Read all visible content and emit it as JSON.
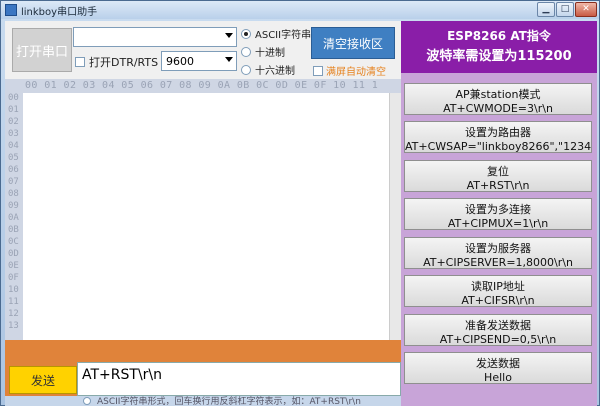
{
  "window": {
    "title": "linkboy串口助手"
  },
  "controls": {
    "open_port_label": "打开串口",
    "port_value": "",
    "dtr_label": "打开DTR/RTS",
    "baud_value": "9600",
    "radios": [
      {
        "label": "ASCII字符串",
        "selected": true
      },
      {
        "label": "十进制",
        "selected": false
      },
      {
        "label": "十六进制",
        "selected": false
      }
    ],
    "clear_rx_label": "清空接收区",
    "auto_clear_label": "满屏自动清空"
  },
  "hex_view": {
    "header": "00 01 02 03 04 05 06 07 08 09 0A 0B 0C 0D 0E 0F 10 11 1",
    "rows": [
      "00",
      "01",
      "02",
      "03",
      "04",
      "05",
      "06",
      "07",
      "08",
      "09",
      "0A",
      "0B",
      "0C",
      "0D",
      "0E",
      "0F",
      "10",
      "11",
      "12",
      "13"
    ]
  },
  "send": {
    "button_label": "发送",
    "input_value": "AT+RST\\r\\n",
    "bottom_note": "ASCII字符串形式，回车换行用反斜杠字符表示，如：AT+RST\\r\\n"
  },
  "panel": {
    "header_line1": "ESP8266 AT指令",
    "header_line2": "波特率需设置为115200",
    "commands": [
      {
        "title": "AP兼station模式",
        "code": "AT+CWMODE=3\\r\\n"
      },
      {
        "title": "设置为路由器",
        "code": "AT+CWSAP=\"linkboy8266\",\"1234"
      },
      {
        "title": "复位",
        "code": "AT+RST\\r\\n"
      },
      {
        "title": "设置为多连接",
        "code": "AT+CIPMUX=1\\r\\n"
      },
      {
        "title": "设置为服务器",
        "code": "AT+CIPSERVER=1,8000\\r\\n"
      },
      {
        "title": "读取IP地址",
        "code": "AT+CIFSR\\r\\n"
      },
      {
        "title": "准备发送数据",
        "code": "AT+CIPSEND=0,5\\r\\n"
      },
      {
        "title": "发送数据",
        "code": "Hello"
      }
    ]
  }
}
